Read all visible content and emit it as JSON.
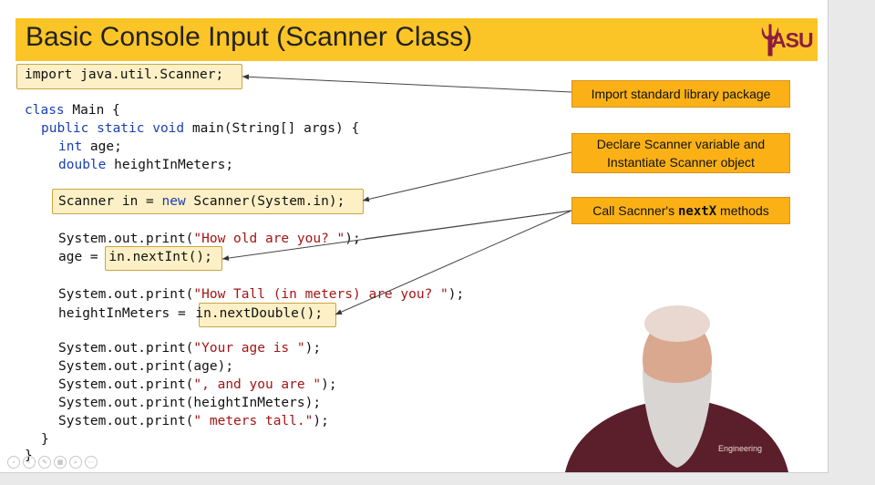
{
  "slide": {
    "title": "Basic Console Input (Scanner Class)",
    "logo_text": "ASU"
  },
  "code": {
    "import_line": "import java.util.Scanner;",
    "class_kw": "class",
    "class_rest": " Main {",
    "main_kw": "public static void",
    "main_rest": " main(String[] args) {",
    "int_kw": "int",
    "int_rest": " age;",
    "double_kw": "double",
    "double_rest": " heightInMeters;",
    "scanner_pre": "Scanner in = ",
    "scanner_kw": "new",
    "scanner_post": " Scanner(System.in);",
    "print1_pre": "System.out.print(",
    "print1_str": "\"How old are you? \"",
    "print1_post": ");",
    "age_assign": "age = ",
    "nextint": "in.nextInt();",
    "print2_pre": "System.out.print(",
    "print2_str": "\"How Tall (in meters) are you? \"",
    "print2_post": ");",
    "height_assign": "heightInMeters = ",
    "nextdouble": "in.nextDouble();",
    "print3_pre": "System.out.print(",
    "print3_str": "\"Your age is \"",
    "print3_post": ");",
    "print4": "System.out.print(age);",
    "print5_pre": "System.out.print(",
    "print5_str": "\", and you are \"",
    "print5_post": ");",
    "print6": "System.out.print(heightInMeters);",
    "print7_pre": "System.out.print(",
    "print7_str": "\" meters tall.\"",
    "print7_post": ");",
    "close_inner": "}",
    "close_outer": "}"
  },
  "callouts": {
    "import": "Import standard library package",
    "declare_line1": "Declare Scanner variable and",
    "declare_line2": "Instantiate Scanner object",
    "call_pre": "Call Sacnner's ",
    "call_bold": "nextX",
    "call_post": " methods"
  },
  "colors": {
    "title_bar": "#fcc527",
    "callout": "#fbb116",
    "highlight": "#fdf0c6",
    "keyword": "#1a3fb0",
    "string": "#a31515",
    "asu_maroon": "#8c1d40"
  },
  "presenter": {
    "shirt_text": "Engineering"
  }
}
